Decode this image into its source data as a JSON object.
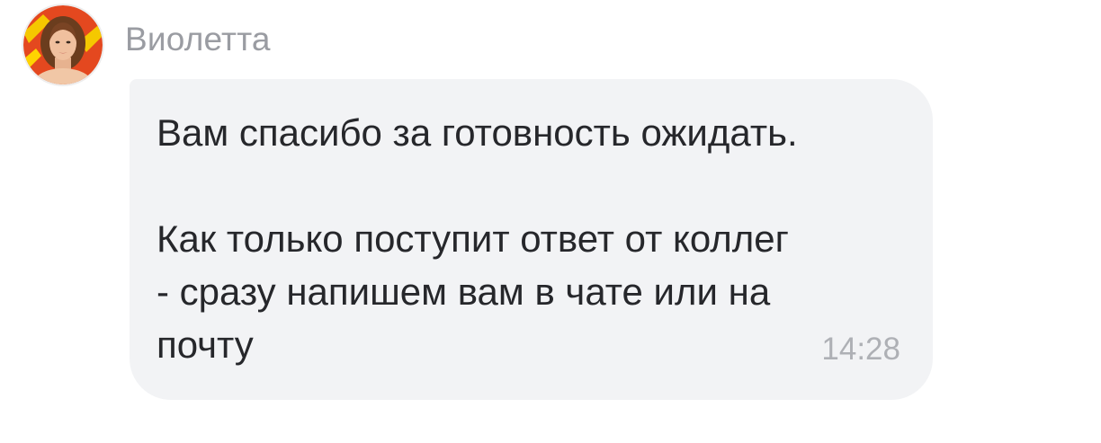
{
  "message": {
    "sender_name": "Виолетта",
    "avatar_icon": "agent-avatar-icon",
    "text": "Вам спасибо за готовность ожидать.\n\nКак только поступит ответ от коллег\n- сразу напишем вам в чате или на\nпочту",
    "time": "14:28"
  },
  "colors": {
    "bubble_background": "#f2f3f5",
    "text": "#26272b",
    "sender_name": "#9a9ca2",
    "timestamp": "#aeb0b5",
    "avatar_accent": "#f5c800"
  }
}
